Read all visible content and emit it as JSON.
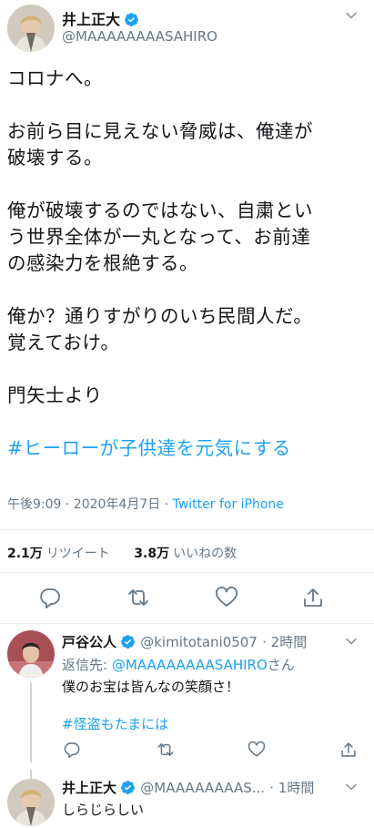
{
  "tweet": {
    "author_name": "井上正大",
    "author_handle": "@MAAAAAAAASAHIRO",
    "lines": [
      "コロナへ。",
      "",
      "お前ら目に見えない脅威は、俺達が",
      "破壊する。",
      "",
      "俺が破壊するのではない、自粛とい",
      "う世界全体が一丸となって、お前達",
      "の感染力を根絶する。",
      "",
      "俺か？通りすがりのいち民間人だ。",
      "覚えておけ。",
      "",
      "門矢士より"
    ],
    "hashtag": "#ヒーローが子供達を元気にする",
    "timestamp": "午後9:09 · 2020年4月7日 · ",
    "source": "Twitter for iPhone",
    "retweets_count": "2.1万",
    "retweets_label": "リツイート",
    "likes_count": "3.8万",
    "likes_label": "いいねの数"
  },
  "icons": {
    "actions": [
      "reply-icon",
      "retweet-icon",
      "like-icon",
      "share-icon"
    ],
    "verified": "verified-badge-icon",
    "menu": "chevron-down-icon"
  },
  "replies": [
    {
      "name": "戸谷公人",
      "handle": "@kimitotani0507",
      "time": "· 2時間",
      "reply_to_prefix": "返信先: ",
      "reply_to_handle": "@MAAAAAAAASAHIRO",
      "reply_to_suffix": "さん",
      "text": "僕のお宝は皆んなの笑顔さ！",
      "hashtag": "#怪盗もたまには"
    },
    {
      "name": "井上正大",
      "handle": "@MAAAAAAAAS...",
      "time": "· 1時間",
      "text": "しらじらしい"
    }
  ],
  "colors": {
    "accent": "#1da1f2",
    "muted": "#657786",
    "text": "#14171a",
    "divider": "#e6ecf0"
  }
}
